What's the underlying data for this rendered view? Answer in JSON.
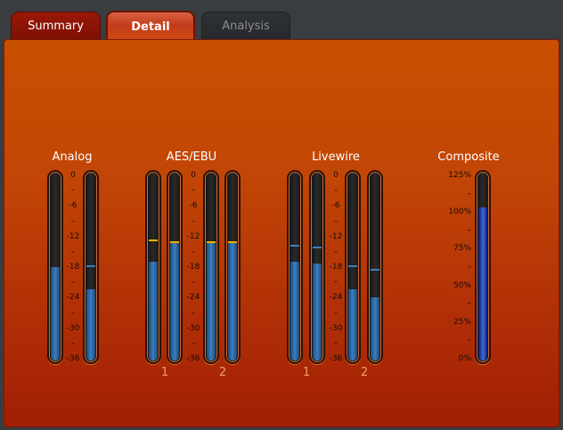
{
  "tabs": [
    {
      "label": "Summary",
      "state": "inactive"
    },
    {
      "label": "Detail",
      "state": "active"
    },
    {
      "label": "Analysis",
      "state": "disabled"
    }
  ],
  "groups": {
    "analog": {
      "title": "Analog"
    },
    "aes": {
      "title": "AES/EBU",
      "channels": [
        "1",
        "2"
      ]
    },
    "livewire": {
      "title": "Livewire",
      "channels": [
        "1",
        "2"
      ]
    },
    "composite": {
      "title": "Composite"
    }
  },
  "db_scale": [
    "0",
    "–",
    "-6",
    "–",
    "-12",
    "–",
    "-18",
    "–",
    "-24",
    "–",
    "-30",
    "–",
    "-36"
  ],
  "percent_scale": [
    "125%",
    "–",
    "100%",
    "–",
    "75%",
    "–",
    "50%",
    "–",
    "25%",
    "–",
    "0%"
  ],
  "colors": {
    "peak_amber": "#f2b200",
    "peak_blue": "#3a7fc0"
  },
  "levels": {
    "analog": [
      0.5,
      0.38
    ],
    "aes": [
      0.53,
      0.63,
      0.63,
      0.63
    ],
    "livewire": [
      0.53,
      0.52,
      0.38,
      0.34
    ],
    "composite": [
      0.82
    ]
  },
  "peaks": {
    "analog": [
      null,
      0.5
    ],
    "aes": [
      0.64,
      0.63,
      0.63,
      0.63
    ],
    "livewire": [
      0.61,
      0.6,
      0.5,
      0.48
    ]
  }
}
